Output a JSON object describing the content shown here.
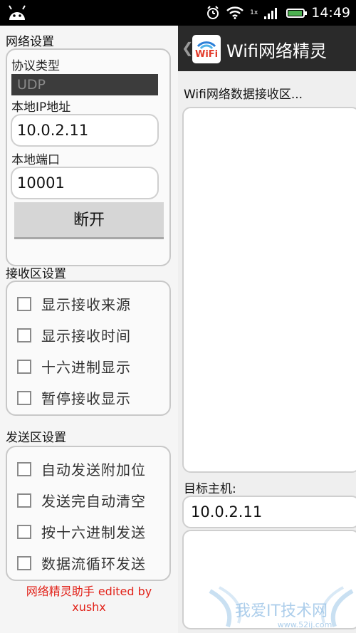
{
  "status_bar": {
    "time": "14:49",
    "network_speed": "1x",
    "icons": [
      "android-icon",
      "alarm-icon",
      "wifi-icon",
      "signal-icon",
      "battery-icon"
    ]
  },
  "drawer": {
    "network": {
      "title": "网络设置",
      "protocol_label": "协议类型",
      "protocol_value": "UDP",
      "ip_label": "本地IP地址",
      "ip_value": "10.0.2.11",
      "port_label": "本地端口",
      "port_value": "10001",
      "disconnect_button": "断开"
    },
    "receive": {
      "title": "接收区设置",
      "options": [
        "显示接收来源",
        "显示接收时间",
        "十六进制显示",
        "暂停接收显示"
      ]
    },
    "send": {
      "title": "发送区设置",
      "options": [
        "自动发送附加位",
        "发送完自动清空",
        "按十六进制发送",
        "数据流循环发送"
      ]
    },
    "credit_line1": "网络精灵助手  edited by",
    "credit_line2": "xushx"
  },
  "action_bar": {
    "title": "Wifi网络精灵",
    "icon_text": "WiFi"
  },
  "main": {
    "receive_label": "Wifi网络数据接收区...",
    "target_label": "目标主机:",
    "target_value": "10.0.2.11"
  },
  "watermark": {
    "text": "我爱IT技术网",
    "url": "www.52ij.com"
  },
  "colors": {
    "accent_red": "#e2231a",
    "action_bar": "#2a2a2a",
    "battery_green": "#4caf50"
  }
}
